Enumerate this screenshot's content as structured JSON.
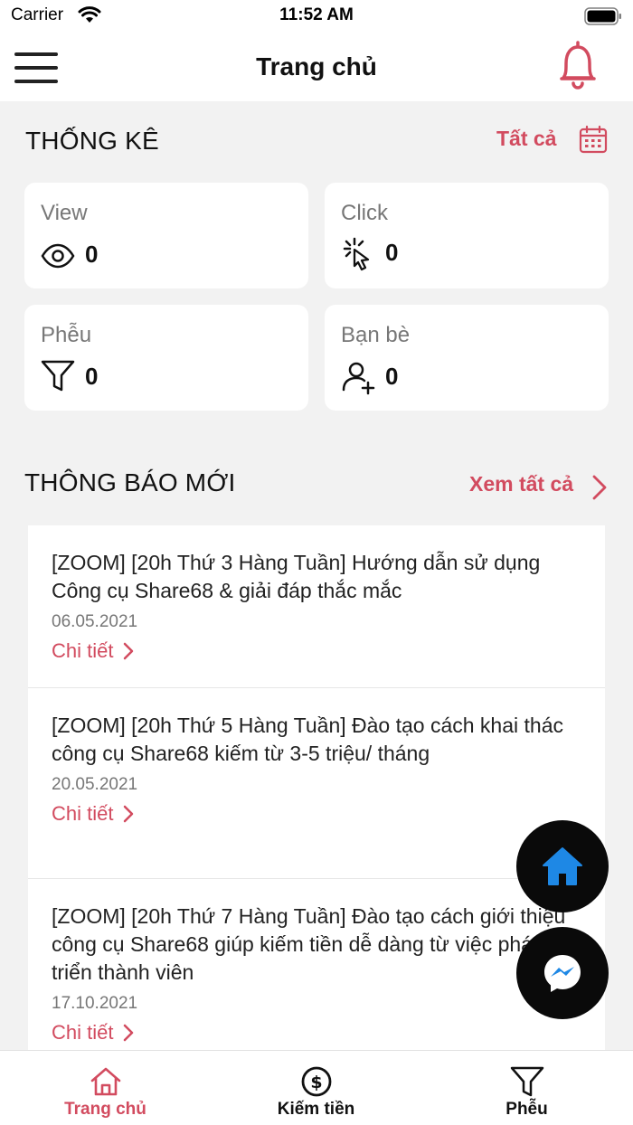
{
  "status_bar": {
    "carrier": "Carrier",
    "time": "11:52 AM"
  },
  "nav": {
    "title": "Trang chủ"
  },
  "stats": {
    "title": "THỐNG KÊ",
    "see_all": "Tất cả",
    "cards": [
      {
        "label": "View",
        "value": "0",
        "icon": "eye-icon"
      },
      {
        "label": "Click",
        "value": "0",
        "icon": "click-cursor-icon"
      },
      {
        "label": "Phễu",
        "value": "0",
        "icon": "funnel-icon"
      },
      {
        "label": "Bạn bè",
        "value": "0",
        "icon": "add-friend-icon"
      }
    ]
  },
  "notices": {
    "title": "THÔNG BÁO MỚI",
    "see_all": "Xem tất cả",
    "items": [
      {
        "title": "[ZOOM] [20h Thứ 3 Hàng Tuần] Hướng dẫn sử dụng Công cụ Share68 & giải đáp thắc mắc",
        "date": "06.05.2021",
        "link": "Chi tiết"
      },
      {
        "title": "[ZOOM] [20h Thứ 5 Hàng Tuần] Đào tạo cách khai thác công cụ Share68 kiếm từ 3-5 triệu/ tháng",
        "date": "20.05.2021",
        "link": "Chi tiết"
      },
      {
        "title": "[ZOOM] [20h Thứ 7 Hàng Tuần] Đào tạo cách giới thiệu công cụ Share68 giúp kiếm tiền dễ dàng từ việc phát triển thành viên",
        "date": "17.10.2021",
        "link": "Chi tiết"
      }
    ]
  },
  "tabs": [
    {
      "label": "Trang chủ",
      "icon": "home-icon",
      "active": true
    },
    {
      "label": "Kiếm tiền",
      "icon": "dollar-coin-icon",
      "active": false
    },
    {
      "label": "Phễu",
      "icon": "funnel-icon",
      "active": false
    }
  ],
  "colors": {
    "accent": "#d24b5f",
    "fab_bg": "#0a0a0a",
    "fab_icon": "#1e88e5"
  }
}
